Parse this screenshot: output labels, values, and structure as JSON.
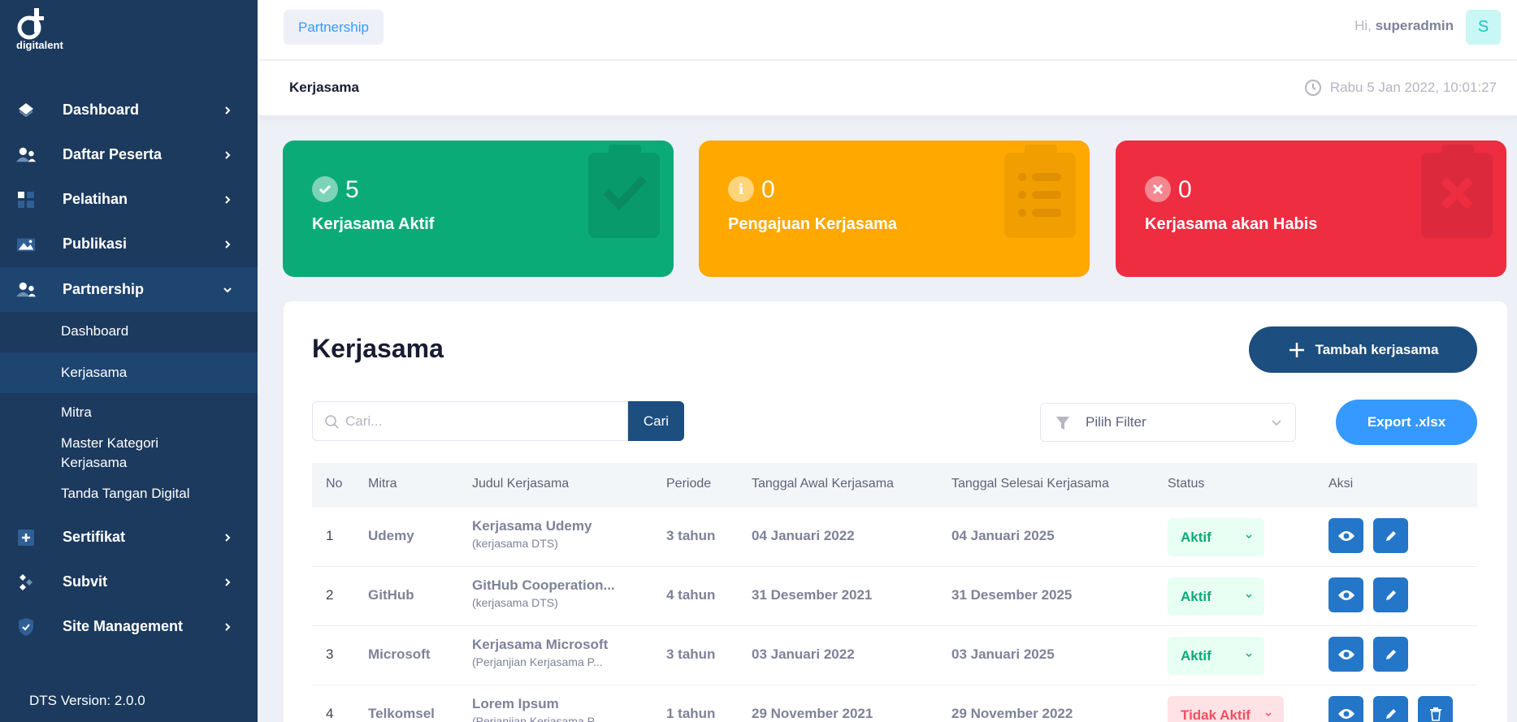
{
  "sidebar": {
    "logo_text": "digitalent",
    "nav": [
      {
        "label": "Dashboard",
        "icon": "diamond-icon"
      },
      {
        "label": "Daftar Peserta",
        "icon": "users-icon"
      },
      {
        "label": "Pelatihan",
        "icon": "grid-icon"
      },
      {
        "label": "Publikasi",
        "icon": "image-icon"
      },
      {
        "label": "Partnership",
        "icon": "users-icon"
      }
    ],
    "partnership_sub": [
      {
        "label": "Dashboard"
      },
      {
        "label": "Kerjasama"
      },
      {
        "label": "Mitra"
      },
      {
        "label": "Master Kategori Kerjasama"
      },
      {
        "label": "Tanda Tangan Digital"
      }
    ],
    "nav_bottom": [
      {
        "label": "Sertifikat",
        "icon": "plus-square-icon"
      },
      {
        "label": "Subvit",
        "icon": "nodes-icon"
      },
      {
        "label": "Site Management",
        "icon": "shield-icon"
      }
    ],
    "version": "DTS Version: 2.0.0"
  },
  "topbar": {
    "breadcrumb": "Partnership",
    "greeting_prefix": "Hi,",
    "username": "superadmin",
    "avatar_letter": "S"
  },
  "subheader": {
    "title": "Kerjasama",
    "datetime": "Rabu 5 Jan 2022, 10:01:27"
  },
  "stats": [
    {
      "value": "5",
      "label": "Kerjasama Aktif",
      "color": "#0bab78"
    },
    {
      "value": "0",
      "label": "Pengajuan Kerjasama",
      "color": "#ffa800"
    },
    {
      "value": "0",
      "label": "Kerjasama akan Habis",
      "color": "#ee2d41"
    }
  ],
  "main": {
    "title": "Kerjasama",
    "add_button": "Tambah kerjasama",
    "search_placeholder": "Cari...",
    "search_button": "Cari",
    "filter_label": "Pilih Filter",
    "export_button": "Export .xlsx",
    "columns": [
      "No",
      "Mitra",
      "Judul Kerjasama",
      "Periode",
      "Tanggal Awal Kerjasama",
      "Tanggal Selesai Kerjasama",
      "Status",
      "Aksi"
    ],
    "rows": [
      {
        "no": "1",
        "mitra": "Udemy",
        "judul": "Kerjasama Udemy",
        "kategori": "(kerjasama DTS)",
        "periode": "3 tahun",
        "awal": "04 Januari 2022",
        "selesai": "04 Januari 2025",
        "status": "Aktif"
      },
      {
        "no": "2",
        "mitra": "GitHub",
        "judul": "GitHub Cooperation...",
        "kategori": "(kerjasama DTS)",
        "periode": "4 tahun",
        "awal": "31 Desember 2021",
        "selesai": "31 Desember 2025",
        "status": "Aktif"
      },
      {
        "no": "3",
        "mitra": "Microsoft",
        "judul": "Kerjasama Microsoft",
        "kategori": "(Perjanjian Kerjasama P...",
        "periode": "3 tahun",
        "awal": "03 Januari 2022",
        "selesai": "03 Januari 2025",
        "status": "Aktif"
      },
      {
        "no": "4",
        "mitra": "Telkomsel",
        "judul": "Lorem Ipsum",
        "kategori": "(Perjanjian Kerjasama P...",
        "periode": "1 tahun",
        "awal": "29 November 2021",
        "selesai": "29 November 2022",
        "status": "Tidak Aktif"
      }
    ]
  }
}
